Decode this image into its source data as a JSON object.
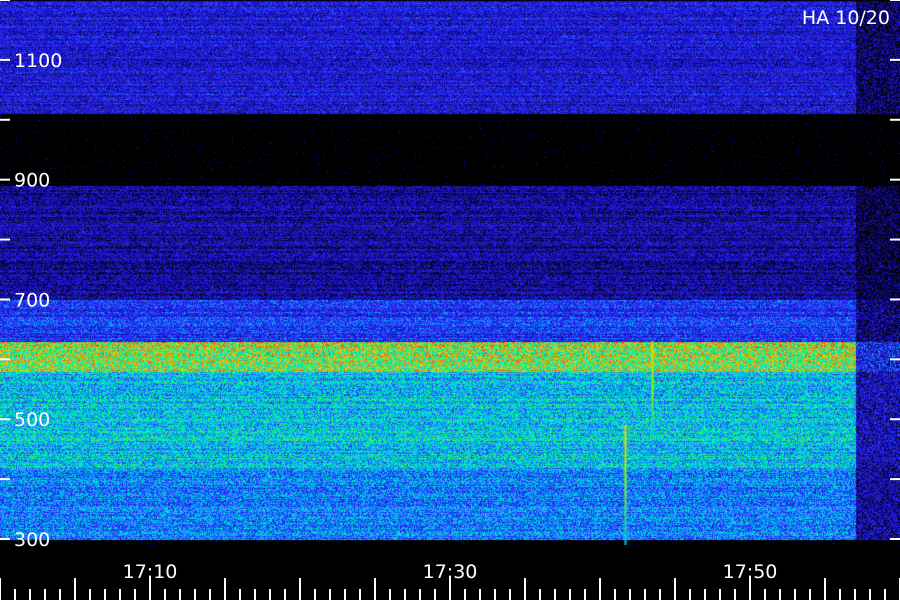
{
  "chart_data": {
    "type": "heatmap",
    "title": "HA 10/20",
    "xlabel": "",
    "ylabel": "",
    "x_ticks": [
      "17:10",
      "17:30",
      "17:50"
    ],
    "y_ticks": [
      "1100",
      "900",
      "700",
      "500",
      "300"
    ],
    "x_range_minutes": [
      0,
      60
    ],
    "x_tick_minutes": [
      10,
      30,
      50
    ],
    "y_range": [
      290,
      1200
    ],
    "y_tick_values": [
      1100,
      900,
      700,
      500,
      300
    ],
    "colormap": [
      "#000000",
      "#1a10c8",
      "#2f2fff",
      "#00c8ff",
      "#00ff80",
      "#ffd000",
      "#ff2000"
    ],
    "bands": [
      {
        "from": 1010,
        "to": 1200,
        "level": 0.22
      },
      {
        "from": 890,
        "to": 1010,
        "level": 0.0
      },
      {
        "from": 700,
        "to": 890,
        "level": 0.14
      },
      {
        "from": 630,
        "to": 700,
        "level": 0.3
      },
      {
        "from": 580,
        "to": 630,
        "level": 0.75
      },
      {
        "from": 420,
        "to": 580,
        "level": 0.52
      },
      {
        "from": 300,
        "to": 420,
        "level": 0.42
      }
    ],
    "end_minutes": 57,
    "bursts": [
      {
        "minute": 43.5,
        "from": 470,
        "to": 630
      },
      {
        "minute": 41.7,
        "from": 290,
        "to": 490
      }
    ]
  }
}
